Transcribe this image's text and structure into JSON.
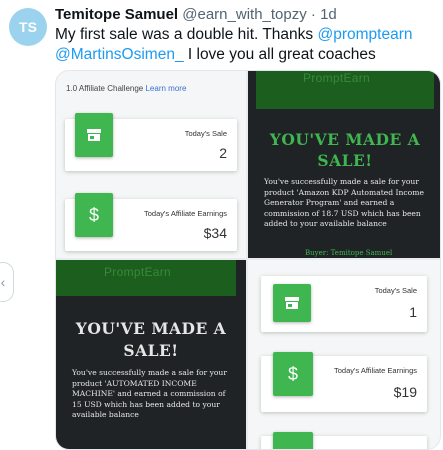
{
  "tweet": {
    "author_name": "Temitope Samuel",
    "author_handle": "@earn_with_topzy",
    "separator": "·",
    "time": "1d",
    "text_before": "My first sale was a double hit. Thanks ",
    "mention_1": "@promptearn",
    "mention_2": "@MartinsOsimen_",
    "text_after": " I love you all great coaches"
  },
  "media": {
    "top_left": {
      "heading": "1.0 Affiliate Challenge",
      "heading_link": "Learn more",
      "sale_label": "Today's Sale",
      "sale_value": "2",
      "earn_label": "Today's Affiliate Earnings",
      "earn_value": "$34"
    },
    "top_right": {
      "logo": "PromptEarn",
      "title": "YOU'VE MADE A SALE!",
      "body": "You've successfully made a sale for your product 'Amazon KDP Automated Income Generator Program' and earned a commission of 18.7 USD which has been added to your available balance",
      "buyer": "Buyer: Temitope Samuel"
    },
    "bottom_left": {
      "logo": "PromptEarn",
      "title": "YOU'VE MADE A SALE!",
      "body": "You've successfully made a sale for your product 'AUTOMATED INCOME MACHINE' and earned a commission of 15 USD which has been added to your available balance"
    },
    "bottom_right": {
      "sale_label": "Today's Sale",
      "sale_value": "1",
      "earn_label": "Today's Affiliate Earnings",
      "earn_value": "$19"
    }
  },
  "icons": {
    "store": "store-icon",
    "dollar": "dollar-icon",
    "carousel_prev": "chevron-left-icon"
  },
  "colors": {
    "mention": "#1d9bf0",
    "green": "#3fb64f",
    "dark_bg": "#1f2326",
    "banner_green": "#1c5e1d"
  }
}
